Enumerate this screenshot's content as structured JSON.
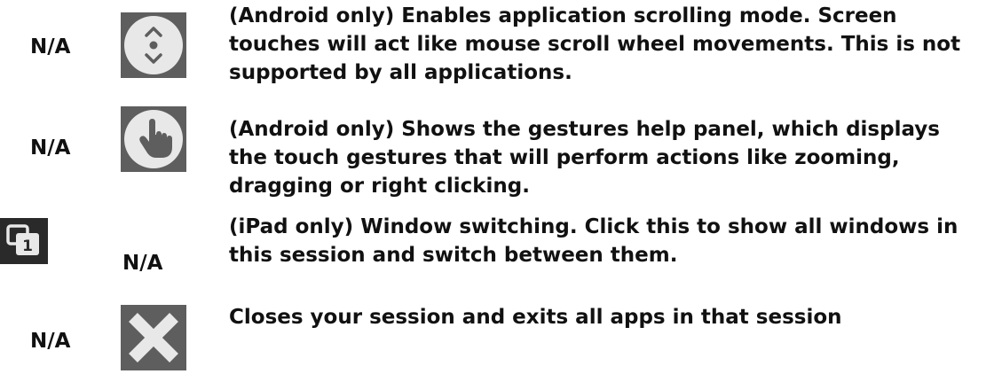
{
  "rows": [
    {
      "ios": "",
      "android": "",
      "na_label": "N/A",
      "icon": "scroll-mode-icon",
      "description": "(Android only) Enables application scrolling mode. Screen touches will act like mouse scroll wheel movements.  This is not supported by all applications."
    },
    {
      "na_label": "N/A",
      "icon": "gestures-help-icon",
      "description": "(Android only) Shows the gestures help panel, which displays the touch gestures that will perform actions like zooming, dragging or right clicking."
    },
    {
      "na_label": "N/A",
      "icon": "window-switch-icon",
      "icon_badge": "1",
      "description": "(iPad only) Window switching.  Click this to show all windows in this session and switch between them."
    },
    {
      "na_label": "N/A",
      "icon": "close-session-icon",
      "description": "Closes your session and exits all apps in that session"
    }
  ],
  "colors": {
    "icon_bg": "#5e5e5e",
    "icon_circle": "#e8e8e8",
    "icon_glyph": "#5e5e5e",
    "window_icon_bg": "#2a2a2a"
  }
}
